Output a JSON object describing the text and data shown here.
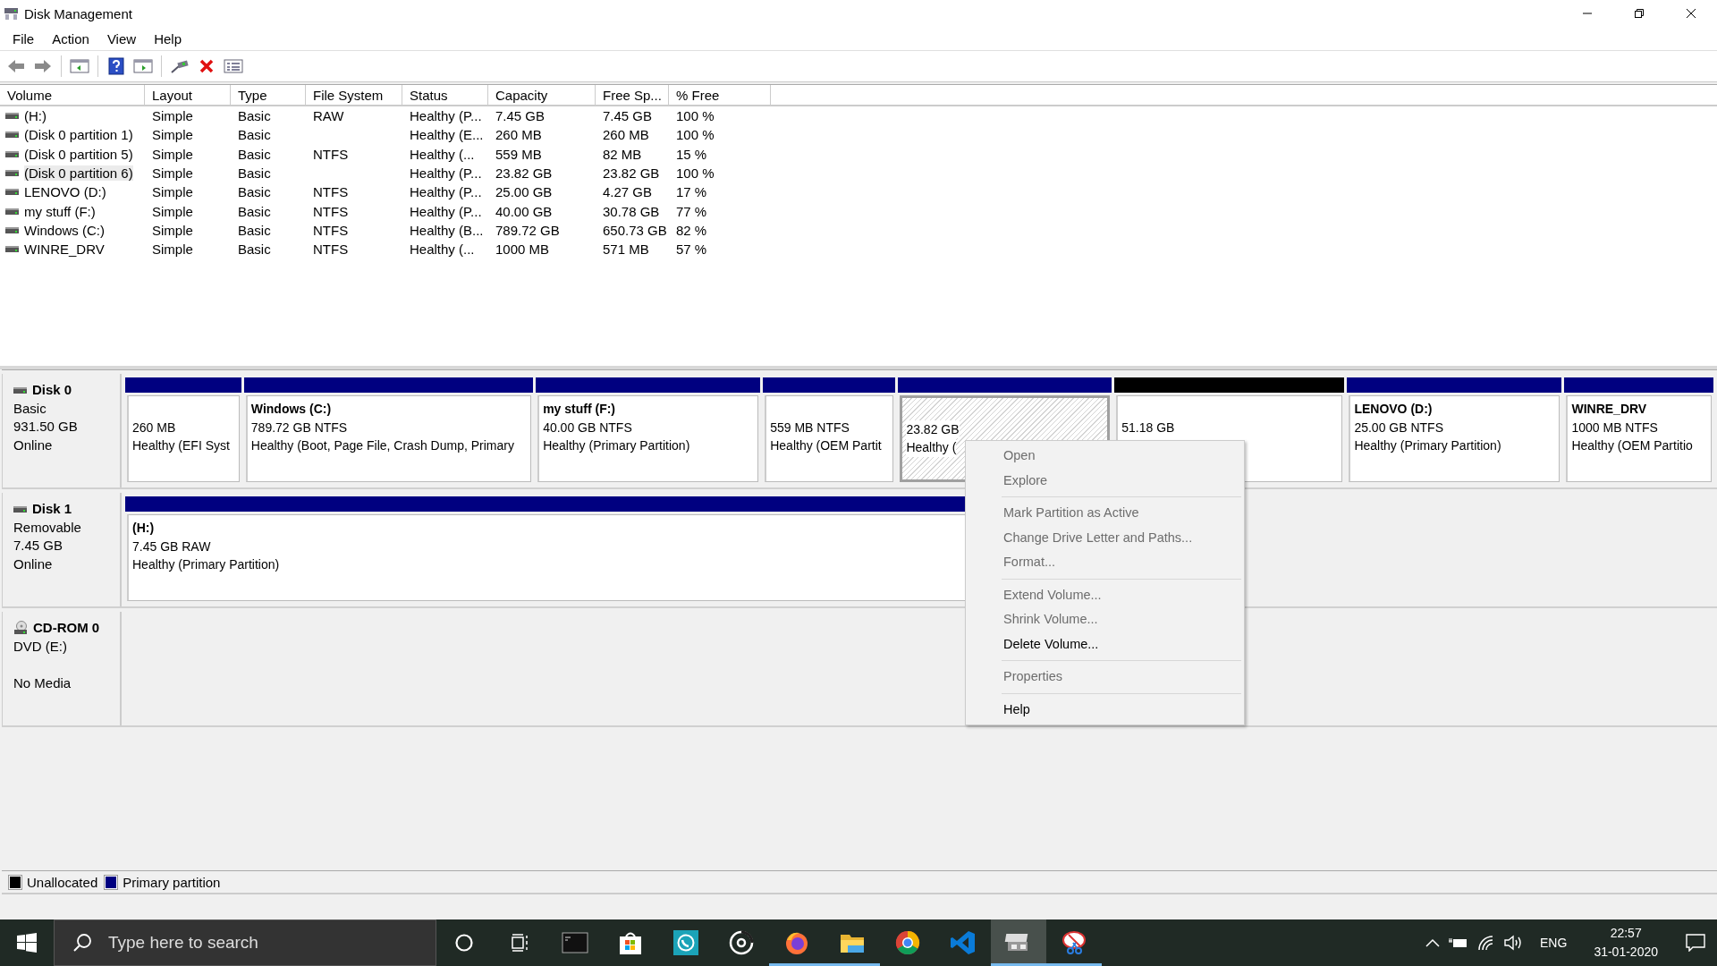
{
  "window": {
    "title": "Disk Management"
  },
  "menu_bar": [
    "File",
    "Action",
    "View",
    "Help"
  ],
  "volume_table": {
    "columns": [
      "Volume",
      "Layout",
      "Type",
      "File System",
      "Status",
      "Capacity",
      "Free Sp...",
      "% Free"
    ],
    "rows": [
      {
        "cells": [
          "(H:)",
          "Simple",
          "Basic",
          "RAW",
          "Healthy (P...",
          "7.45 GB",
          "7.45 GB",
          "100 %"
        ],
        "selected": false
      },
      {
        "cells": [
          "(Disk 0 partition 1)",
          "Simple",
          "Basic",
          "",
          "Healthy (E...",
          "260 MB",
          "260 MB",
          "100 %"
        ],
        "selected": false
      },
      {
        "cells": [
          "(Disk 0 partition 5)",
          "Simple",
          "Basic",
          "NTFS",
          "Healthy (...",
          "559 MB",
          "82 MB",
          "15 %"
        ],
        "selected": false
      },
      {
        "cells": [
          "(Disk 0 partition 6)",
          "Simple",
          "Basic",
          "",
          "Healthy (P...",
          "23.82 GB",
          "23.82 GB",
          "100 %"
        ],
        "selected": true
      },
      {
        "cells": [
          "LENOVO (D:)",
          "Simple",
          "Basic",
          "NTFS",
          "Healthy (P...",
          "25.00 GB",
          "4.27 GB",
          "17 %"
        ],
        "selected": false
      },
      {
        "cells": [
          "my stuff (F:)",
          "Simple",
          "Basic",
          "NTFS",
          "Healthy (P...",
          "40.00 GB",
          "30.78 GB",
          "77 %"
        ],
        "selected": false
      },
      {
        "cells": [
          "Windows (C:)",
          "Simple",
          "Basic",
          "NTFS",
          "Healthy (B...",
          "789.72 GB",
          "650.73 GB",
          "82 %"
        ],
        "selected": false
      },
      {
        "cells": [
          "WINRE_DRV",
          "Simple",
          "Basic",
          "NTFS",
          "Healthy (...",
          "1000 MB",
          "571 MB",
          "57 %"
        ],
        "selected": false
      }
    ]
  },
  "disks": [
    {
      "name": "Disk 0",
      "kind": "disk",
      "type": "Basic",
      "size": "931.50 GB",
      "status": "Online",
      "partitions": [
        {
          "kind": "primary",
          "selected": false,
          "size": "260 MB",
          "status": "Healthy (EFI Syst"
        },
        {
          "kind": "primary",
          "selected": false,
          "name": "Windows  (C:)",
          "size": "789.72 GB NTFS",
          "status": "Healthy (Boot, Page File, Crash Dump, Primary"
        },
        {
          "kind": "primary",
          "selected": false,
          "name": "my stuff  (F:)",
          "size": "40.00 GB NTFS",
          "status": "Healthy (Primary Partition)"
        },
        {
          "kind": "primary",
          "selected": false,
          "size": "559 MB NTFS",
          "status": "Healthy (OEM Partit"
        },
        {
          "kind": "primary",
          "selected": true,
          "size": "23.82 GB",
          "status": "Healthy ("
        },
        {
          "kind": "unallocated",
          "selected": false,
          "size": "51.18 GB"
        },
        {
          "kind": "primary",
          "selected": false,
          "name": "LENOVO  (D:)",
          "size": "25.00 GB NTFS",
          "status": "Healthy (Primary Partition)"
        },
        {
          "kind": "primary",
          "selected": false,
          "name": "WINRE_DRV",
          "size": "1000 MB NTFS",
          "status": "Healthy (OEM Partitio"
        }
      ]
    },
    {
      "name": "Disk 1",
      "kind": "disk",
      "type": "Removable",
      "size": "7.45 GB",
      "status": "Online",
      "partitions": [
        {
          "kind": "primary",
          "selected": false,
          "name": "(H:)",
          "size": "7.45 GB RAW",
          "status": "Healthy (Primary Partition)"
        }
      ]
    },
    {
      "name": "CD-ROM 0",
      "kind": "cdrom",
      "type": "DVD (E:)",
      "status": "No Media"
    }
  ],
  "legend": [
    {
      "label": "Unallocated",
      "color": "#000000"
    },
    {
      "label": "Primary partition",
      "color": "#000080"
    }
  ],
  "context_menu": {
    "groups": [
      [
        {
          "label": "Open",
          "disabled": true
        },
        {
          "label": "Explore",
          "disabled": true
        }
      ],
      [
        {
          "label": "Mark Partition as Active",
          "disabled": true
        },
        {
          "label": "Change Drive Letter and Paths...",
          "disabled": true
        },
        {
          "label": "Format...",
          "disabled": true
        }
      ],
      [
        {
          "label": "Extend Volume...",
          "disabled": true
        },
        {
          "label": "Shrink Volume...",
          "disabled": true
        },
        {
          "label": "Delete Volume...",
          "disabled": false
        }
      ],
      [
        {
          "label": "Properties",
          "disabled": true
        }
      ],
      [
        {
          "label": "Help",
          "disabled": false
        }
      ]
    ]
  },
  "taskbar": {
    "search": {
      "placeholder": "Type here to search"
    },
    "apps": [
      {
        "running": false,
        "active": false
      },
      {
        "running": false,
        "active": false
      },
      {
        "running": false,
        "active": false
      },
      {
        "running": false,
        "active": false
      },
      {
        "running": true,
        "active": false
      },
      {
        "running": true,
        "active": false
      },
      {
        "running": false,
        "active": false
      },
      {
        "running": false,
        "active": false
      },
      {
        "running": true,
        "active": true
      },
      {
        "running": true,
        "active": false
      }
    ],
    "language": "ENG",
    "time": "22:57",
    "date": "31-01-2020"
  }
}
